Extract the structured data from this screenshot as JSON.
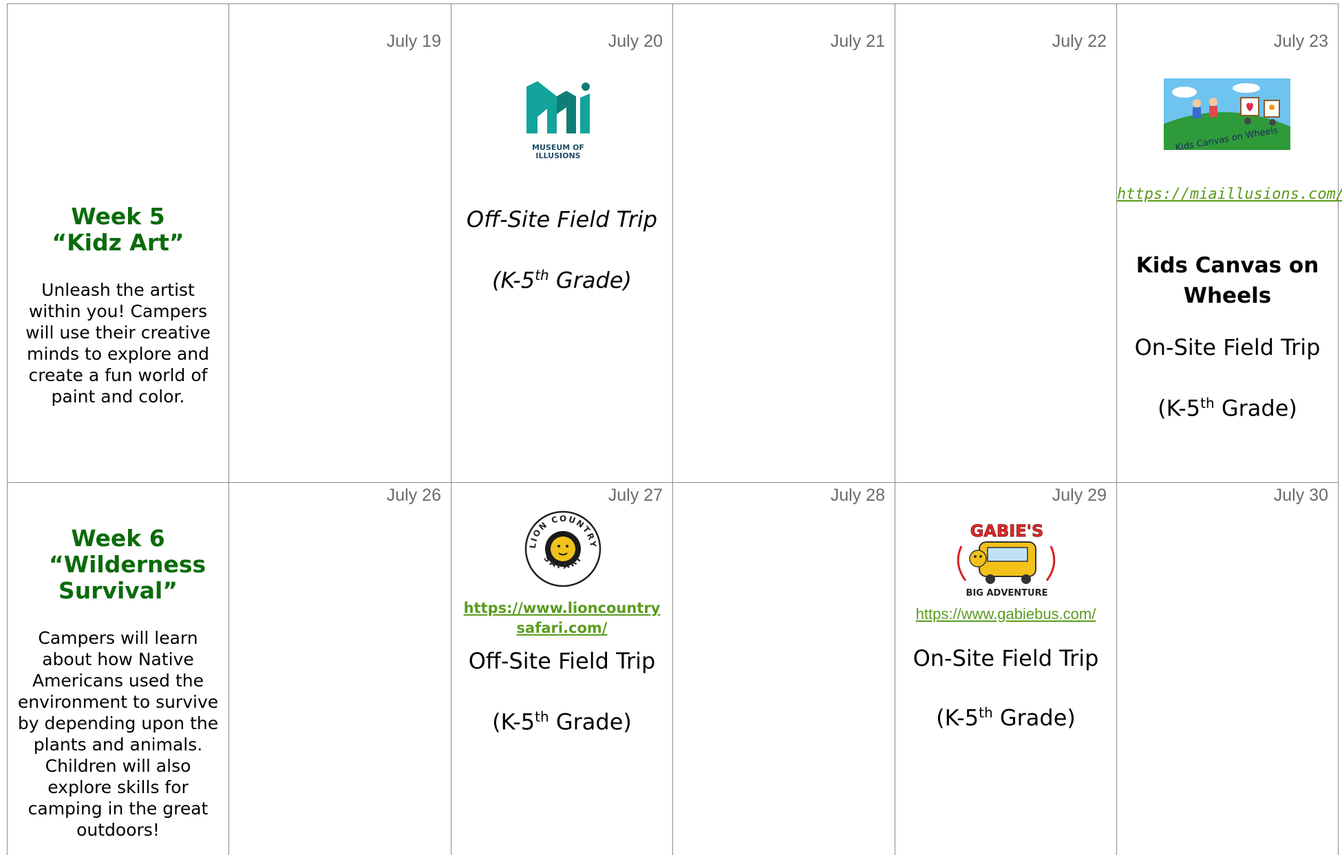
{
  "week5": {
    "title_line1": "Week 5",
    "title_line2": "“Kidz Art”",
    "description": "Unleash the artist within you! Campers will use their creative minds to explore and create a fun world of paint and color."
  },
  "week6": {
    "title_line1": "Week 6",
    "title_line2": "“Wilderness Survival”",
    "description": "Campers will learn about how Native Americans used the environment to survive by depending upon the plants and animals. Children will also explore skills for camping in the great outdoors!"
  },
  "row1": {
    "dates": [
      "July 19",
      "July 20",
      "July 21",
      "July 22",
      "July 23"
    ],
    "jul20": {
      "logo_text_line1": "MUSEUM OF",
      "logo_text_line2": "ILLUSIONS",
      "trip": "Off-Site Field Trip",
      "grade_prefix": "(K-5",
      "grade_sup": "th",
      "grade_suffix": " Grade)"
    },
    "jul23": {
      "logo_text": "Kids Canvas on Wheels",
      "link": "https://miaillusions.com/",
      "partner_name": "Kids Canvas on Wheels",
      "trip": "On-Site Field Trip",
      "grade_prefix": "(K-5",
      "grade_sup": "th",
      "grade_suffix": " Grade)"
    }
  },
  "row2": {
    "dates": [
      "July 26",
      "July 27",
      "July 28",
      "July 29",
      "July 30"
    ],
    "jul27": {
      "logo_text_top": "LION COUNTRY",
      "logo_text_bottom": "SAFARI",
      "link": "https://www.lioncountrysafari.com/",
      "trip": "Off-Site Field Trip",
      "grade_prefix": "(K-5",
      "grade_sup": "th",
      "grade_suffix": " Grade)"
    },
    "jul29": {
      "logo_text_top": "GABIE'S",
      "logo_text_bottom": "BIG ADVENTURE",
      "link": "https://www.gabiebus.com/",
      "trip": "On-Site Field Trip",
      "grade_prefix": "(K-5",
      "grade_sup": "th",
      "grade_suffix": " Grade)"
    }
  },
  "colors": {
    "week_title": "#0a6b0a",
    "link": "#5a9c1e",
    "date": "#6b6b6b",
    "grid": "#8c8c8c"
  }
}
